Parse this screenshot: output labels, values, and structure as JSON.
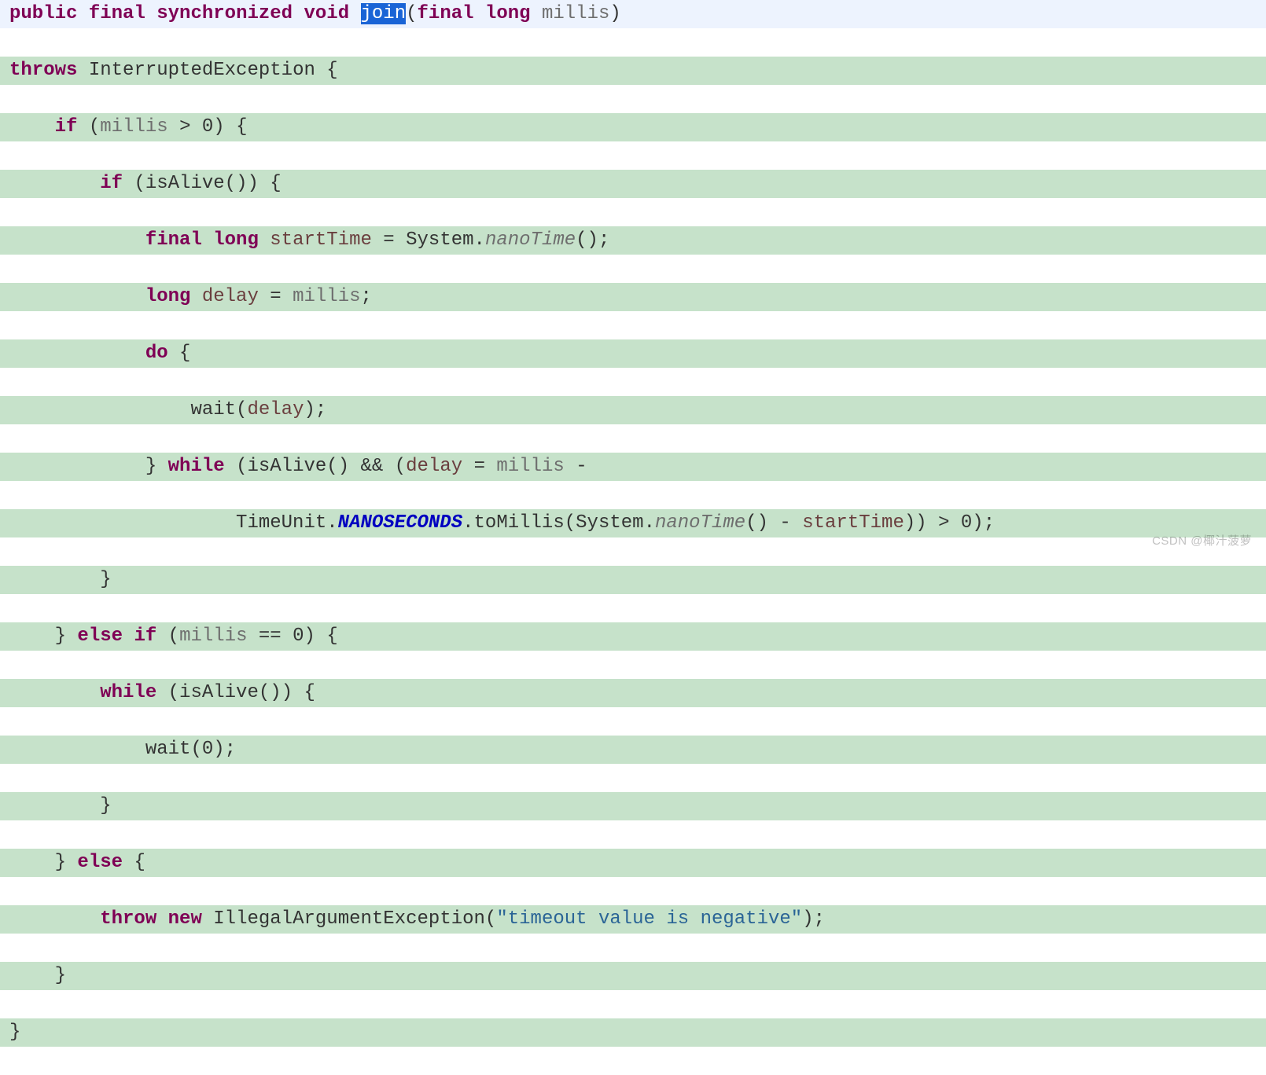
{
  "code": {
    "l1": {
      "k_public": "public",
      "sp": " ",
      "k_final": "final",
      "k_sync": "synchronized",
      "k_void": "void",
      "m_join": "join",
      "lp": "(",
      "k_final2": "final",
      "k_long": "long",
      "p_millis": "millis",
      "rp": ")"
    },
    "l2": {
      "k_throws": "throws",
      "exc": "InterruptedException",
      "brace": "{"
    },
    "l3": {
      "indent": "    ",
      "k_if": "if",
      "lp": "(",
      "v": "millis",
      "op": ">",
      "zero": "0",
      "rp": ")",
      "brace": "{"
    },
    "l4": {
      "indent": "        ",
      "k_if": "if",
      "lp": "(",
      "call": "isAlive",
      "ps": "()",
      "rp": ")",
      "brace": "{"
    },
    "l5": {
      "indent": "            ",
      "k_final": "final",
      "k_long": "long",
      "v": "startTime",
      "eq": "=",
      "cls": "System",
      "dot": ".",
      "nano": "nanoTime",
      "ps": "()",
      ";": ";"
    },
    "l6": {
      "indent": "            ",
      "k_long": "long",
      "v": "delay",
      "eq": "=",
      "v2": "millis",
      ";": ";"
    },
    "l7": {
      "indent": "            ",
      "k_do": "do",
      "brace": "{"
    },
    "l8": {
      "indent": "                ",
      "call": "wait",
      "lp": "(",
      "v": "delay",
      "rp": ")",
      ";": ";"
    },
    "l9": {
      "indent": "            ",
      "rb": "}",
      "k_while": "while",
      "lp": "(",
      "call": "isAlive",
      "ps": "()",
      "amp": "&&",
      "lp2": "(",
      "v": "delay",
      "eq": "=",
      "v2": "millis",
      "minus": "-"
    },
    "l10": {
      "indent": "                    ",
      "cls": "TimeUnit",
      "dot": ".",
      "nanos": "NANOSECONDS",
      "dot2": ".",
      "tomillis": "toMillis",
      "lp": "(",
      "sys": "System",
      "dot3": ".",
      "nano": "nanoTime",
      "ps": "()",
      "minus": "-",
      "v": "startTime",
      "rp": ")",
      ")": ")",
      "gt": ">",
      "zero": "0",
      "rp2": ")",
      ";": ";"
    },
    "l11": {
      "indent": "        ",
      "rb": "}"
    },
    "l12": {
      "indent": "    ",
      "rb": "}",
      "k_else": "else",
      "k_if": "if",
      "lp": "(",
      "v": "millis",
      "op": "==",
      "zero": "0",
      "rp": ")",
      "brace": "{"
    },
    "l13": {
      "indent": "        ",
      "k_while": "while",
      "lp": "(",
      "call": "isAlive",
      "ps": "()",
      "rp": ")",
      "brace": "{"
    },
    "l14": {
      "indent": "            ",
      "call": "wait",
      "lp": "(",
      "zero": "0",
      "rp": ")",
      ";": ";"
    },
    "l15": {
      "indent": "        ",
      "rb": "}"
    },
    "l16": {
      "indent": "    ",
      "rb": "}",
      "k_else": "else",
      "brace": "{"
    },
    "l17": {
      "indent": "        ",
      "k_throw": "throw",
      "k_new": "new",
      "cls": "IllegalArgumentException",
      "lp": "(",
      "str": "\"timeout value is negative\"",
      "rp": ")",
      ";": ";"
    },
    "l18": {
      "indent": "    ",
      "rb": "}"
    },
    "l19": {
      "rb": "}"
    }
  },
  "watermark": "CSDN @椰汁菠萝"
}
